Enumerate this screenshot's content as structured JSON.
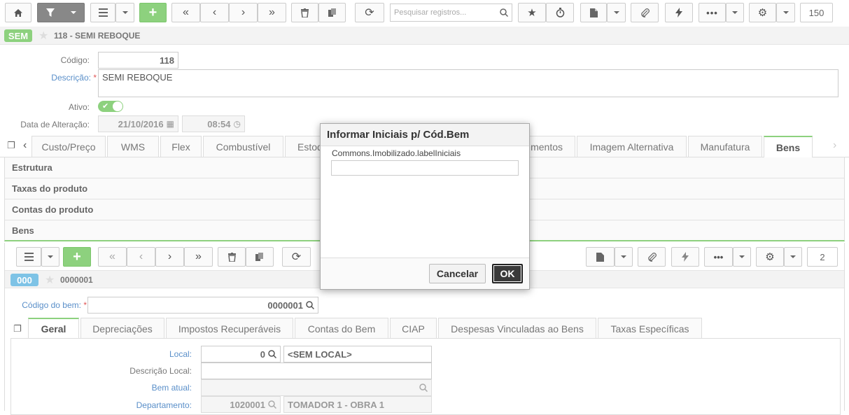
{
  "toolbar": {
    "search_placeholder": "Pesquisar registros...",
    "count": "150"
  },
  "record": {
    "badge": "SEM",
    "title": "118 - SEMI REBOQUE",
    "codigo_label": "Código:",
    "codigo_value": "118",
    "descricao_label": "Descrição:",
    "descricao_value": "SEMI REBOQUE",
    "ativo_label": "Ativo:",
    "data_label": "Data de Alteração:",
    "data_value": "21/10/2016",
    "hora_value": "08:54",
    "required_mark": "*"
  },
  "tabs": [
    {
      "label": "Custo/Preço"
    },
    {
      "label": "WMS"
    },
    {
      "label": "Flex"
    },
    {
      "label": "Combustível"
    },
    {
      "label": "Estoque"
    },
    {
      "label": "mentos"
    },
    {
      "label": "Imagem Alternativa"
    },
    {
      "label": "Manufatura"
    },
    {
      "label": "Bens"
    }
  ],
  "sections": [
    "Estrutura",
    "Taxas do produto",
    "Contas do produto",
    "Bens"
  ],
  "bens_toolbar": {
    "count": "2"
  },
  "bem": {
    "badge": "000",
    "title": "0000001",
    "codigo_label": "Código do bem:",
    "codigo_value": "0000001"
  },
  "sub_tabs": [
    {
      "label": "Geral"
    },
    {
      "label": "Depreciações"
    },
    {
      "label": "Impostos Recuperáveis"
    },
    {
      "label": "Contas do Bem"
    },
    {
      "label": "CIAP"
    },
    {
      "label": "Despesas Vinculadas ao Bens"
    },
    {
      "label": "Taxas Específicas"
    }
  ],
  "geral": {
    "local_label": "Local:",
    "local_code": "0",
    "local_name": "<SEM LOCAL>",
    "desc_local_label": "Descrição Local:",
    "bem_atual_label": "Bem atual:",
    "departamento_label": "Departamento:",
    "departamento_code": "1020001",
    "departamento_name": "TOMADOR 1 - OBRA 1"
  },
  "dialog": {
    "title": "Informar Iniciais p/ Cód.Bem",
    "field_label": "Commons.Imobilizado.labelIniciais",
    "field_value": "",
    "cancel_label": "Cancelar",
    "ok_label": "OK"
  }
}
